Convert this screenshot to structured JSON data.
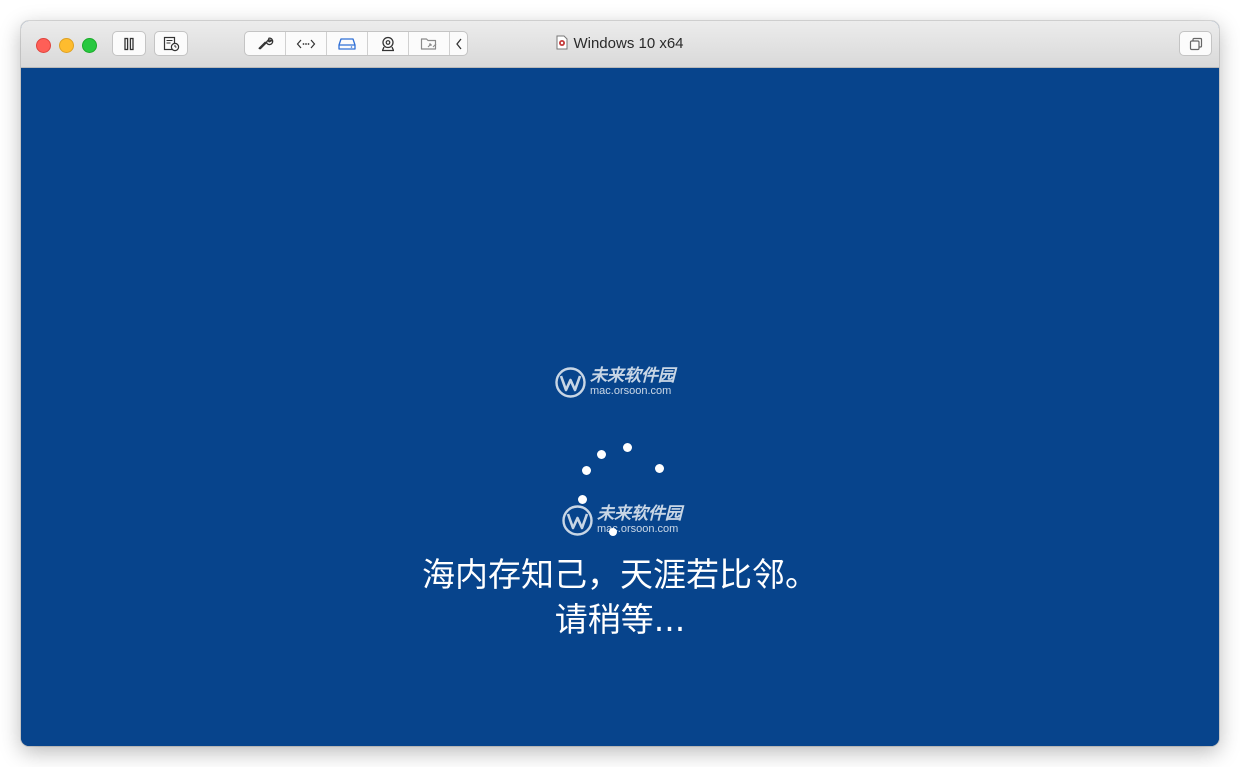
{
  "window": {
    "title": "Windows 10 x64",
    "doc_icon": "vm-document-icon"
  },
  "toolbar": {
    "buttons": [
      {
        "name": "pause-icon"
      },
      {
        "name": "snapshot-icon"
      },
      {
        "name": "wrench-icon"
      },
      {
        "name": "code-arrows-icon"
      },
      {
        "name": "hard-disk-icon"
      },
      {
        "name": "camera-icon"
      },
      {
        "name": "shared-folder-icon"
      },
      {
        "name": "chevron-left-icon"
      },
      {
        "name": "restore-window-icon"
      }
    ]
  },
  "screen": {
    "background_color": "#07448c",
    "message_line1": "海内存知己，天涯若比邻。",
    "message_line2": "请稍等..."
  },
  "watermark": {
    "name": "未来软件园",
    "url": "mac.orsoon.com"
  },
  "colors": {
    "close": "#fe5f57",
    "minimize": "#febc2e",
    "maximize": "#28c840",
    "accent_icon": "#2f6fd6"
  }
}
